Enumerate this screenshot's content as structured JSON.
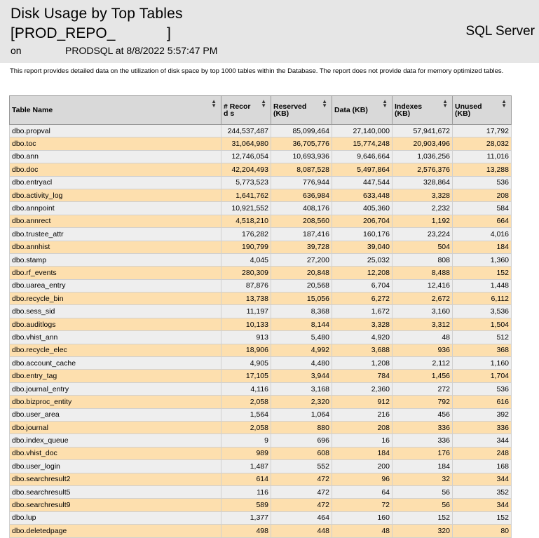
{
  "report": {
    "title_line1": "Disk Usage by Top Tables",
    "title_line2_open": "[PROD_REPO_",
    "title_line2_close": "]",
    "product": "SQL Server",
    "meta_on": "on",
    "meta_server": "PRODSQL at 8/8/2022 5:57:47 PM",
    "description": "This report provides detailed data on the utilization of disk space by top 1000 tables within the Database. The report does not provide data for memory optimized tables."
  },
  "table": {
    "headers": [
      "Table Name",
      "# Record s",
      "Reserved (KB)",
      "Data (KB)",
      "Indexes (KB)",
      "Unused (KB)"
    ],
    "rows": [
      [
        "dbo.propval",
        "244,537,487",
        "85,099,464",
        "27,140,000",
        "57,941,672",
        "17,792"
      ],
      [
        "dbo.toc",
        "31,064,980",
        "36,705,776",
        "15,774,248",
        "20,903,496",
        "28,032"
      ],
      [
        "dbo.ann",
        "12,746,054",
        "10,693,936",
        "9,646,664",
        "1,036,256",
        "11,016"
      ],
      [
        "dbo.doc",
        "42,204,493",
        "8,087,528",
        "5,497,864",
        "2,576,376",
        "13,288"
      ],
      [
        "dbo.entryacl",
        "5,773,523",
        "776,944",
        "447,544",
        "328,864",
        "536"
      ],
      [
        "dbo.activity_log",
        "1,641,762",
        "636,984",
        "633,448",
        "3,328",
        "208"
      ],
      [
        "dbo.annpoint",
        "10,921,552",
        "408,176",
        "405,360",
        "2,232",
        "584"
      ],
      [
        "dbo.annrect",
        "4,518,210",
        "208,560",
        "206,704",
        "1,192",
        "664"
      ],
      [
        "dbo.trustee_attr",
        "176,282",
        "187,416",
        "160,176",
        "23,224",
        "4,016"
      ],
      [
        "dbo.annhist",
        "190,799",
        "39,728",
        "39,040",
        "504",
        "184"
      ],
      [
        "dbo.stamp",
        "4,045",
        "27,200",
        "25,032",
        "808",
        "1,360"
      ],
      [
        "dbo.rf_events",
        "280,309",
        "20,848",
        "12,208",
        "8,488",
        "152"
      ],
      [
        "dbo.uarea_entry",
        "87,876",
        "20,568",
        "6,704",
        "12,416",
        "1,448"
      ],
      [
        "dbo.recycle_bin",
        "13,738",
        "15,056",
        "6,272",
        "2,672",
        "6,112"
      ],
      [
        "dbo.sess_sid",
        "11,197",
        "8,368",
        "1,672",
        "3,160",
        "3,536"
      ],
      [
        "dbo.auditlogs",
        "10,133",
        "8,144",
        "3,328",
        "3,312",
        "1,504"
      ],
      [
        "dbo.vhist_ann",
        "913",
        "5,480",
        "4,920",
        "48",
        "512"
      ],
      [
        "dbo.recycle_elec",
        "18,906",
        "4,992",
        "3,688",
        "936",
        "368"
      ],
      [
        "dbo.account_cache",
        "4,905",
        "4,480",
        "1,208",
        "2,112",
        "1,160"
      ],
      [
        "dbo.entry_tag",
        "17,105",
        "3,944",
        "784",
        "1,456",
        "1,704"
      ],
      [
        "dbo.journal_entry",
        "4,116",
        "3,168",
        "2,360",
        "272",
        "536"
      ],
      [
        "dbo.bizproc_entity",
        "2,058",
        "2,320",
        "912",
        "792",
        "616"
      ],
      [
        "dbo.user_area",
        "1,564",
        "1,064",
        "216",
        "456",
        "392"
      ],
      [
        "dbo.journal",
        "2,058",
        "880",
        "208",
        "336",
        "336"
      ],
      [
        "dbo.index_queue",
        "9",
        "696",
        "16",
        "336",
        "344"
      ],
      [
        "dbo.vhist_doc",
        "989",
        "608",
        "184",
        "176",
        "248"
      ],
      [
        "dbo.user_login",
        "1,487",
        "552",
        "200",
        "184",
        "168"
      ],
      [
        "dbo.searchresult2",
        "614",
        "472",
        "96",
        "32",
        "344"
      ],
      [
        "dbo.searchresult5",
        "116",
        "472",
        "64",
        "56",
        "352"
      ],
      [
        "dbo.searchresult9",
        "589",
        "472",
        "72",
        "56",
        "344"
      ],
      [
        "dbo.lup",
        "1,377",
        "464",
        "160",
        "152",
        "152"
      ],
      [
        "dbo.deletedpage",
        "498",
        "448",
        "48",
        "320",
        "80"
      ]
    ]
  },
  "icons": {
    "sort": "sort-arrows-icon"
  },
  "colors": {
    "header_bg": "#e6e6e6",
    "row_odd": "#eeeeee",
    "row_even": "#fddfae",
    "th_bg": "#d9d9d9"
  }
}
